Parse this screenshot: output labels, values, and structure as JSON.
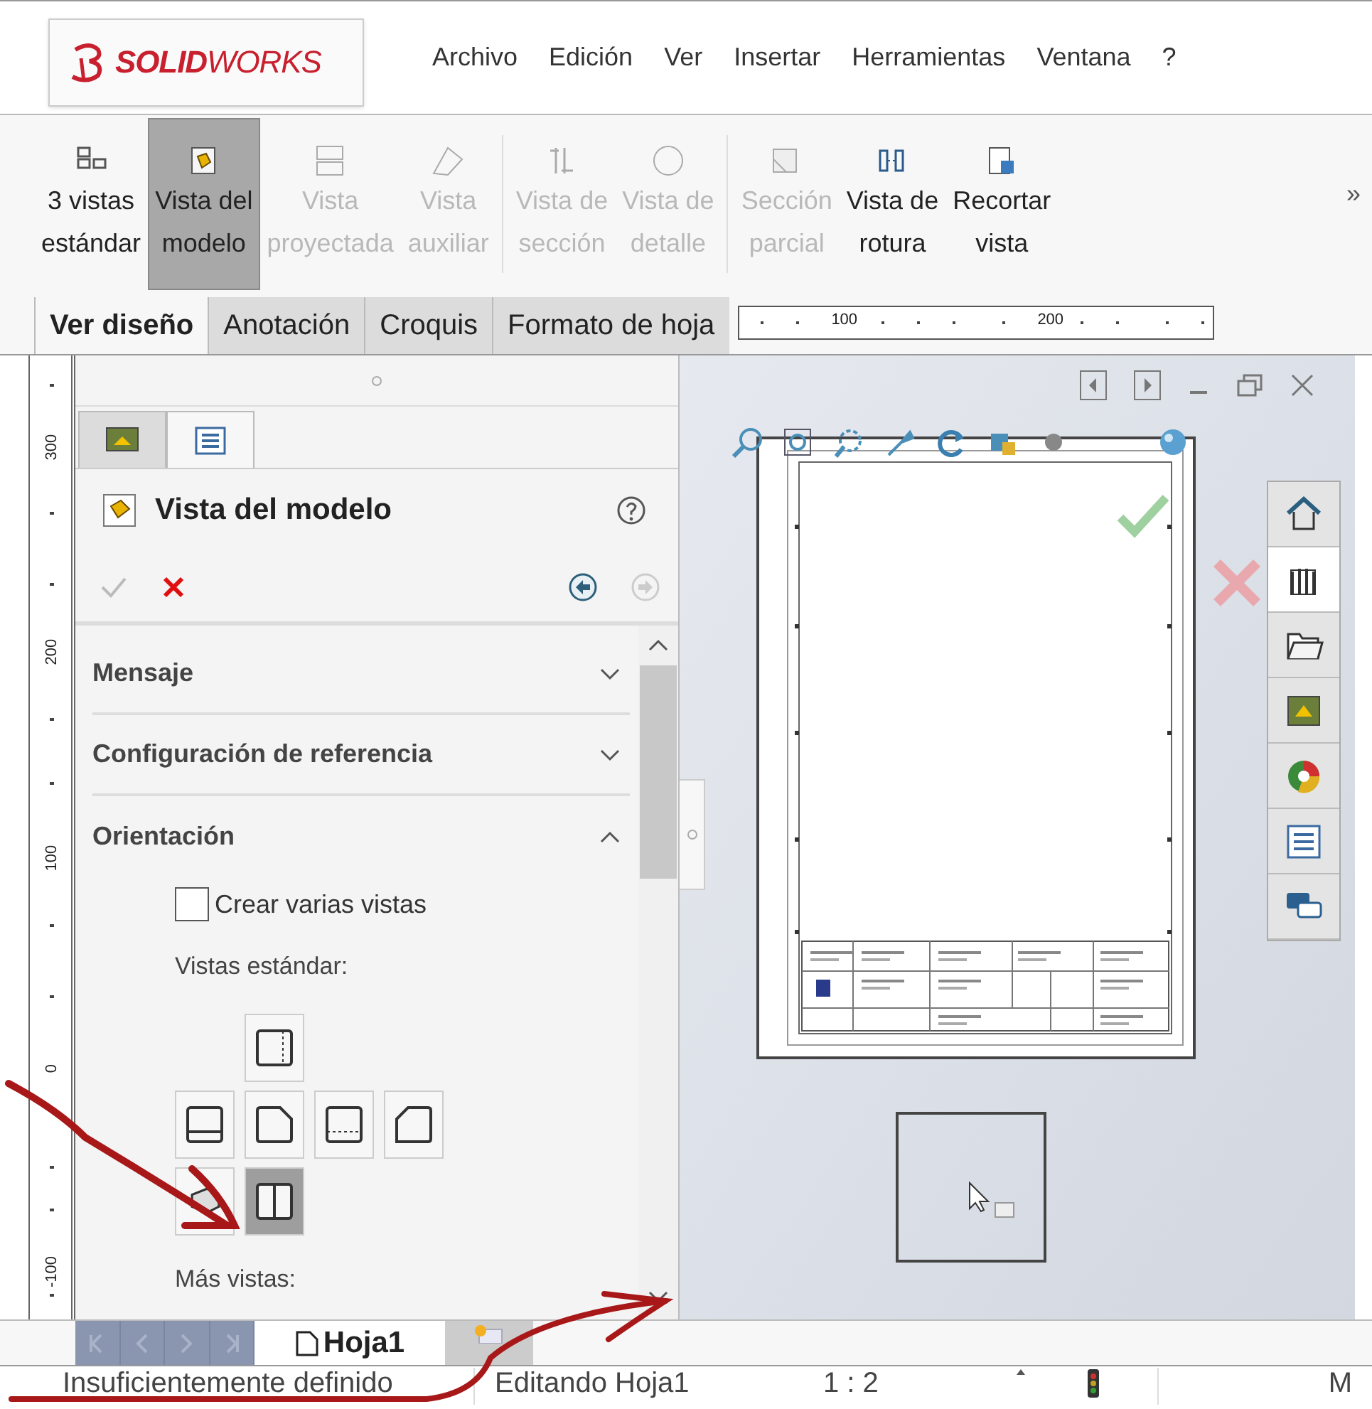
{
  "app": {
    "logo": "**SOLID**WORKS"
  },
  "menu": [
    "Archivo",
    "Edición",
    "Ver",
    "Insertar",
    "Herramientas",
    "Ventana",
    "?"
  ],
  "toolbar": {
    "buttons": [
      {
        "lines": [
          "3 vistas",
          "estándar"
        ],
        "selected": false,
        "disabled": false
      },
      {
        "lines": [
          "Vista del",
          "modelo"
        ],
        "selected": true,
        "disabled": false
      },
      {
        "lines": [
          "Vista",
          "proyectada"
        ],
        "selected": false,
        "disabled": true
      },
      {
        "lines": [
          "Vista",
          "auxiliar"
        ],
        "selected": false,
        "disabled": true
      },
      {
        "lines": [
          "Vista de",
          "sección"
        ],
        "selected": false,
        "disabled": true
      },
      {
        "lines": [
          "Vista de",
          "detalle"
        ],
        "selected": false,
        "disabled": true
      },
      {
        "lines": [
          "Sección",
          "parcial"
        ],
        "selected": false,
        "disabled": true
      },
      {
        "lines": [
          "Vista de",
          "rotura"
        ],
        "selected": false,
        "disabled": false
      },
      {
        "lines": [
          "Recortar",
          "vista"
        ],
        "selected": false,
        "disabled": false
      }
    ],
    "overflow": "»"
  },
  "tabs": [
    {
      "label": "Ver diseño",
      "selected": true
    },
    {
      "label": "Anotación",
      "selected": false
    },
    {
      "label": "Croquis",
      "selected": false
    },
    {
      "label": "Formato de hoja",
      "selected": false
    }
  ],
  "ruler_h": [
    "100",
    "200"
  ],
  "ruler_v": [
    "300",
    "200",
    "100",
    "0",
    "-100"
  ],
  "panel": {
    "tabs": [
      {
        "selected": false
      },
      {
        "selected": true
      }
    ],
    "title": "Vista del modelo",
    "ok": {
      "disabled": true
    },
    "back": {
      "disabled": false
    },
    "forward": {
      "disabled": true
    },
    "sections": [
      {
        "title": "Mensaje",
        "expanded": false
      },
      {
        "title": "Configuración de referencia",
        "expanded": false
      },
      {
        "title": "Orientación",
        "expanded": true
      }
    ],
    "create_multiple": {
      "label": "Crear varias vistas",
      "checked": false
    },
    "standard_views_label": "Vistas estándar:",
    "views": [
      {
        "selected": false
      },
      {
        "selected": false
      },
      {
        "selected": false
      },
      {
        "selected": false
      },
      {
        "selected": false
      },
      {
        "selected": false
      },
      {
        "selected": true
      }
    ],
    "more_views_label": "Más vistas:"
  },
  "sheet_tabs": [
    {
      "label": "Hoja1",
      "selected": true
    }
  ],
  "status_bar": [
    "Insuficientemente definido",
    "Editando Hoja1",
    "1 : 2",
    "M"
  ]
}
